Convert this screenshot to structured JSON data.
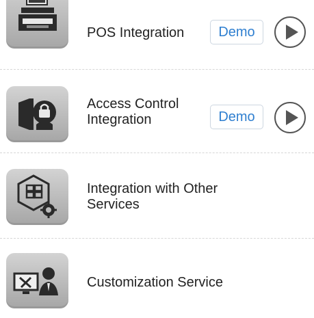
{
  "items": [
    {
      "label": "POS Integration",
      "icon": "cash-register-icon",
      "demo_label": "Demo",
      "play_icon": "play-icon"
    },
    {
      "label": "Access Control\nIntegration",
      "icon": "access-lock-icon",
      "demo_label": "Demo",
      "play_icon": "play-icon"
    },
    {
      "label": "Integration with Other\nServices",
      "icon": "integration-gear-icon"
    },
    {
      "label": "Customization Service",
      "icon": "customization-tools-icon"
    }
  ],
  "colors": {
    "demo_text": "#2f7fd0",
    "tile_gray": "#b8b8b8",
    "play": "#555555"
  }
}
